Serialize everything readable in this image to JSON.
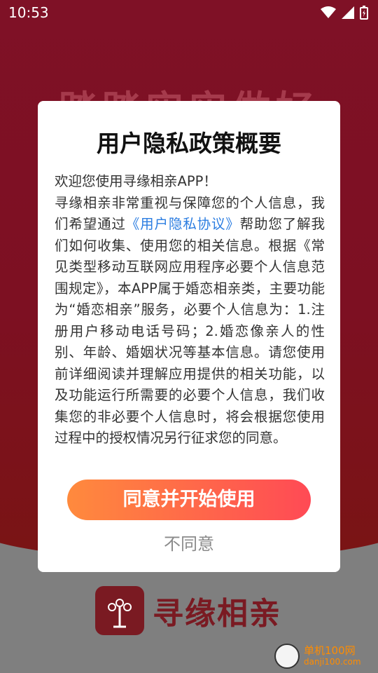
{
  "status_bar": {
    "time": "10:53"
  },
  "background": {
    "slogan": "踏踏实实做好",
    "app_name": "寻缘相亲"
  },
  "dialog": {
    "title": "用户隐私政策概要",
    "body_before_link": "欢迎您使用寻缘相亲APP！\n寻缘相亲非常重视与保障您的个人信息，我们希望通过",
    "link_text": "《用户隐私协议》",
    "body_after_link": "帮助您了解我们如何收集、使用您的相关信息。根据《常见类型移动互联网应用程序必要个人信息范围规定》，本APP属于婚恋相亲类，主要功能为“婚恋相亲”服务，必要个人信息为：1.注册用户移动电话号码；2.婚恋像亲人的性别、年龄、婚姻状况等基本信息。请您使用前详细阅读并理解应用提供的相关功能，以及功能运行所需要的必要个人信息，我们收集您的非必要个人信息时，将会根据您使用过程中的授权情况另行征求您的同意。",
    "agree_label": "同意并开始使用",
    "disagree_label": "不同意"
  },
  "watermark": {
    "line1": "单机100网",
    "line2": "danji100.com"
  }
}
